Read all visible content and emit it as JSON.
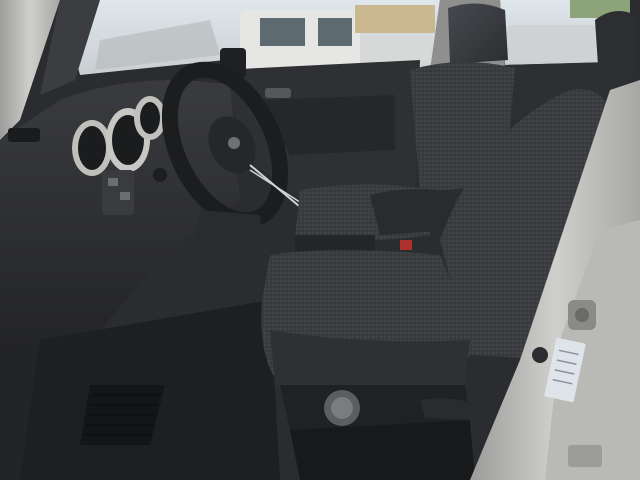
{
  "photo": {
    "subject": "car-interior-front-seats",
    "colors": {
      "seat_fabric": "#35373a",
      "seat_fabric_light": "#4a4d52",
      "dashboard": "#2b2c2f",
      "carpet": "#1e1f22",
      "door_frame_silver": "#b9b9b6",
      "sky_outside": "#e8eef2",
      "truck_white": "#e6e6e4",
      "sticker": "#dfe4ea"
    }
  }
}
